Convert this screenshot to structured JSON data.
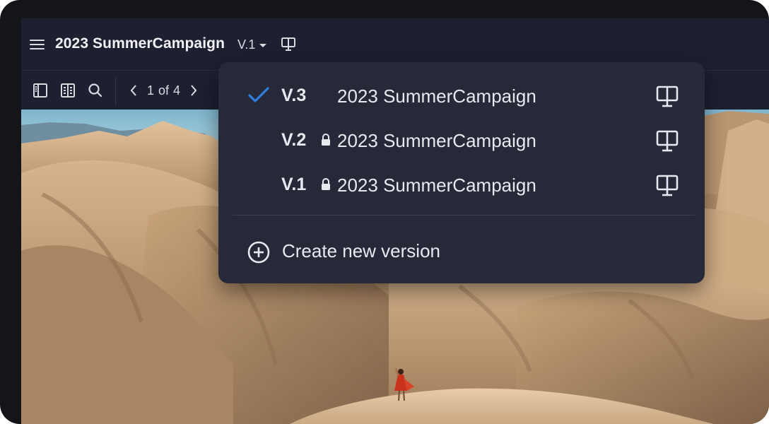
{
  "header": {
    "title": "2023 SummerCampaign",
    "version_selected": "V.1"
  },
  "toolbar": {
    "page_current": "1",
    "page_of": "of",
    "page_total": "4"
  },
  "dropdown": {
    "versions": [
      {
        "label": "V.3",
        "name": "2023 SummerCampaign",
        "checked": true,
        "locked": false
      },
      {
        "label": "V.2",
        "name": "2023 SummerCampaign",
        "checked": false,
        "locked": true
      },
      {
        "label": "V.1",
        "name": "2023 SummerCampaign",
        "checked": false,
        "locked": true
      }
    ],
    "create_label": "Create new version"
  },
  "icons": {
    "menu": "hamburger-icon",
    "present": "presentation-icon",
    "sidebar": "sidebar-toggle-icon",
    "grid": "page-grid-icon",
    "search": "search-icon",
    "prev": "chevron-left-icon",
    "next": "chevron-right-icon",
    "check": "checkmark-icon",
    "lock": "lock-icon",
    "add": "add-circle-icon"
  },
  "colors": {
    "accent_check": "#2f7de1",
    "panel": "#262937",
    "app_bg": "#1d2030",
    "text": "#e7e9ef"
  }
}
